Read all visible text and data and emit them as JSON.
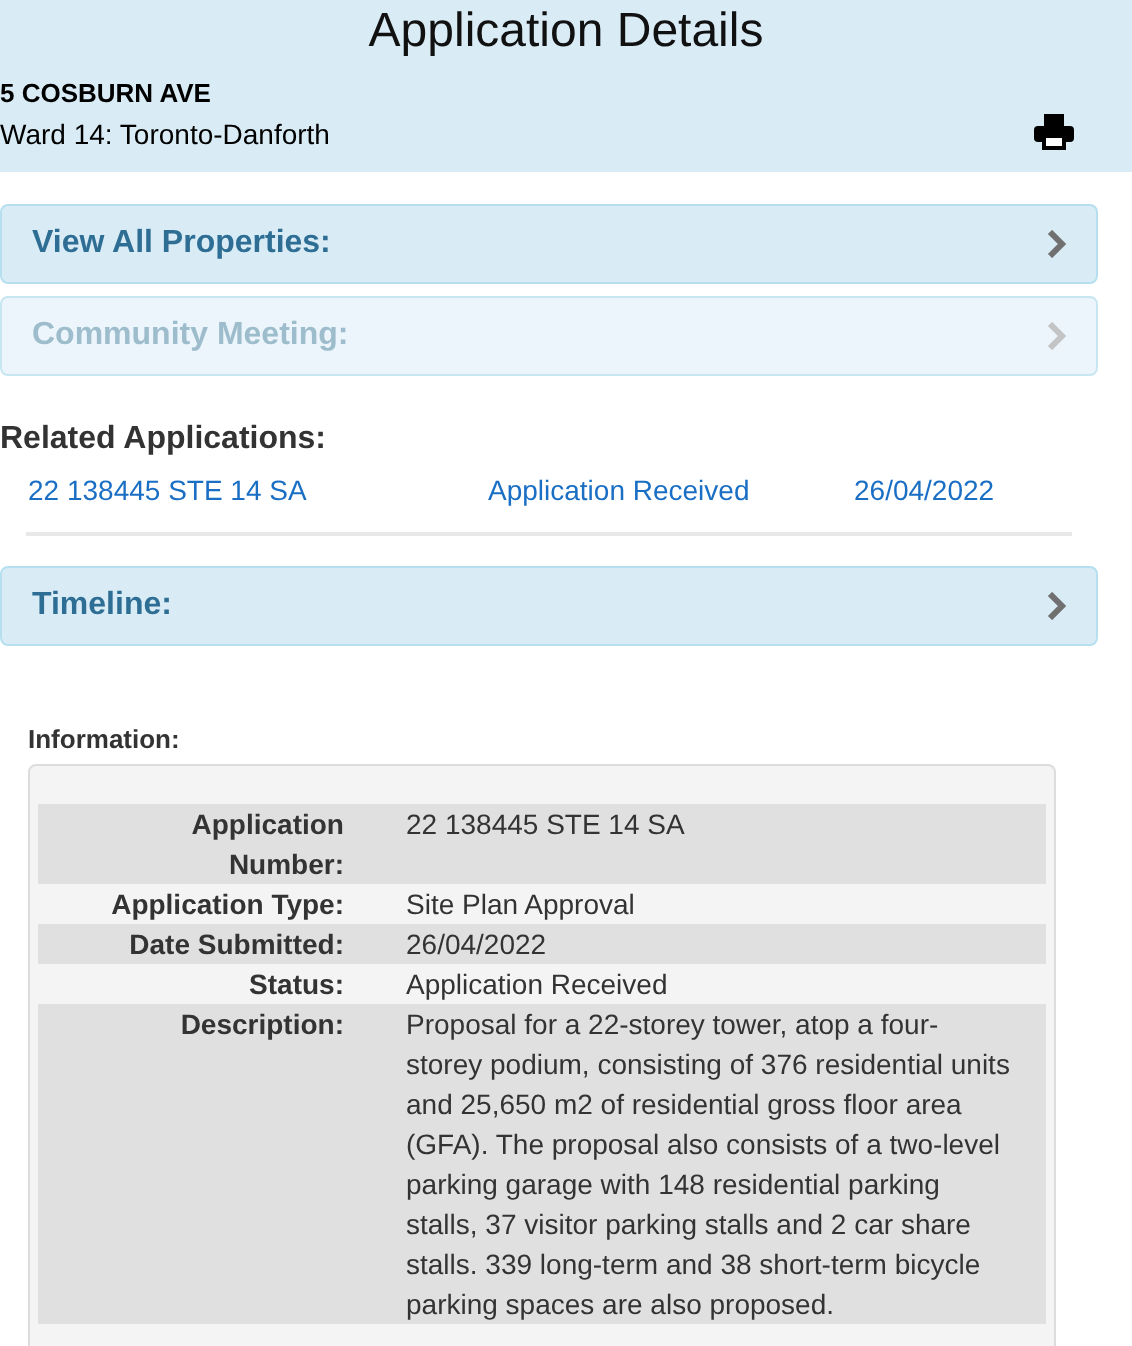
{
  "header": {
    "title": "Application Details",
    "address": "5 COSBURN AVE",
    "ward": "Ward 14: Toronto-Danforth"
  },
  "panels": [
    {
      "label": "View All Properties:",
      "disabled": false
    },
    {
      "label": "Community Meeting:",
      "disabled": true
    }
  ],
  "related": {
    "heading": "Related Applications:",
    "rows": [
      {
        "number": "22 138445 STE 14 SA",
        "status": "Application Received",
        "date": "26/04/2022"
      }
    ]
  },
  "timeline": {
    "label": "Timeline:",
    "disabled": false
  },
  "information": {
    "heading": "Information:",
    "rows": [
      {
        "label": "Application Number:",
        "value": "22 138445 STE 14 SA"
      },
      {
        "label": "Application Type:",
        "value": "Site Plan Approval"
      },
      {
        "label": "Date Submitted:",
        "value": "26/04/2022"
      },
      {
        "label": "Status:",
        "value": "Application Received"
      },
      {
        "label": "Description:",
        "value": "Proposal for a 22-storey tower, atop a four-storey podium, consisting of 376 residential units and 25,650 m2 of residential gross floor area (GFA). The proposal also consists of a two-level parking garage with 148 residential parking stalls, 37 visitor parking stalls and 2 car share stalls. 339 long-term and 38 short-term bicycle parking spaces are also proposed."
      }
    ]
  }
}
